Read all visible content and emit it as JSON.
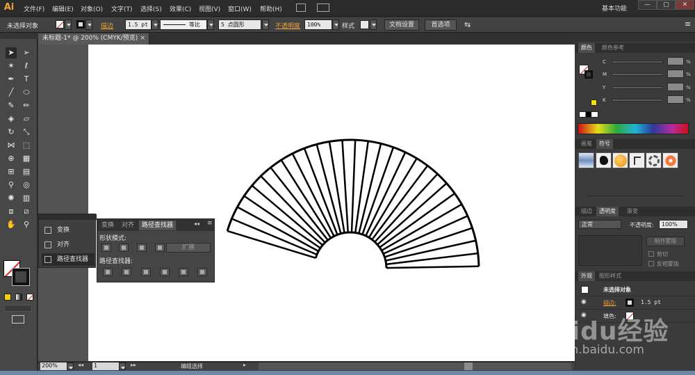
{
  "app": {
    "logo": "Ai",
    "workspace": "基本功能",
    "window_buttons": [
      "—",
      "▢",
      "✕"
    ]
  },
  "menu": [
    "文件(F)",
    "编辑(E)",
    "对象(O)",
    "文字(T)",
    "选择(S)",
    "效果(C)",
    "视图(V)",
    "窗口(W)",
    "帮助(H)"
  ],
  "control": {
    "selection_label": "未选择对象",
    "stroke_label": "描边",
    "stroke_width": "1.5 pt",
    "profile_label": "等比",
    "brush_label": "5 点圆形",
    "opacity_label": "不透明度",
    "opacity_value": "100%",
    "style_label": "样式",
    "doc_setup_button": "文档设置",
    "prefs_button": "首选项"
  },
  "document_tab": "未标题-1* @ 200% (CMYK/预览)",
  "mini_panel": {
    "items": [
      "变换",
      "对齐",
      "路径查找器"
    ]
  },
  "pathfinder": {
    "tabs": [
      "变换",
      "对齐",
      "路径查找器"
    ],
    "shape_modes_label": "形状模式:",
    "expand_button": "扩展",
    "pathfinders_label": "路径查找器:"
  },
  "color_panel": {
    "tabs": [
      "颜色",
      "颜色参考"
    ],
    "channels": [
      "C",
      "M",
      "Y",
      "K"
    ],
    "percent": "%"
  },
  "symbols_panel": {
    "tabs": [
      "画笔",
      "符号"
    ]
  },
  "transparency_panel": {
    "tabs": [
      "描边",
      "透明度",
      "渐变"
    ],
    "blend_mode": "正常",
    "opacity_label": "不透明度:",
    "opacity_value": "100%",
    "make_mask_button": "制作蒙版",
    "clip_label": "剪切",
    "invert_label": "反相蒙版"
  },
  "appearance_panel": {
    "tabs": [
      "外观",
      "图形样式"
    ],
    "title": "未选择对象",
    "stroke_label": "描边:",
    "stroke_value": "1.5 pt",
    "fill_label": "填色:"
  },
  "status": {
    "zoom": "200%",
    "page": "1",
    "selection_tool": "编组选择"
  },
  "watermark": {
    "main": "Baidu经验",
    "url": "jingyan.baidu.com"
  },
  "colors": {
    "fill_none_slash": "#e0221a",
    "stroke": "#111111",
    "accent_orange": "#e9a23b",
    "artboard": "#ffffff",
    "pasteboard": "#535353"
  },
  "fan_artwork": {
    "rib_count": 28,
    "stroke_color": "#000000"
  }
}
